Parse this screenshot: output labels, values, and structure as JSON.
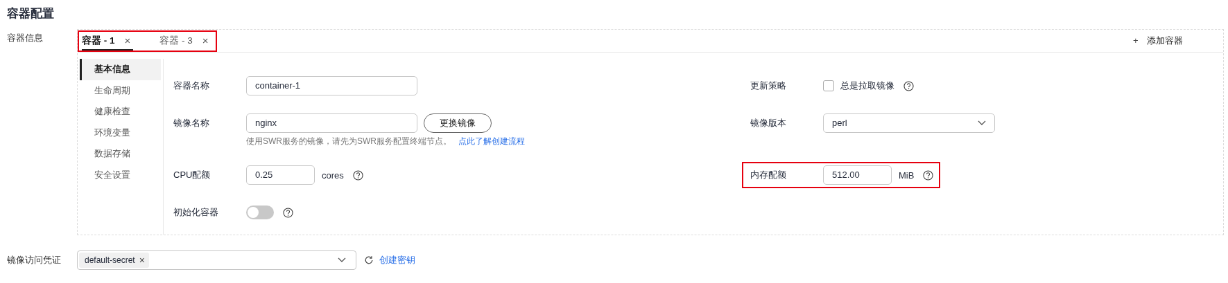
{
  "section_title": "容器配置",
  "container_info": {
    "label": "容器信息",
    "tabs_highlighted": true,
    "tabs": [
      {
        "label": "容器 - 1",
        "selected": true,
        "close": "×"
      },
      {
        "label": "容器 - 3",
        "selected": false,
        "close": "×"
      }
    ],
    "add_button": {
      "icon": "+",
      "label": "添加容器"
    },
    "sidebar": [
      {
        "label": "基本信息",
        "selected": true
      },
      {
        "label": "生命周期",
        "selected": false
      },
      {
        "label": "健康检查",
        "selected": false
      },
      {
        "label": "环境变量",
        "selected": false
      },
      {
        "label": "数据存储",
        "selected": false
      },
      {
        "label": "安全设置",
        "selected": false
      }
    ],
    "fields_left": [
      {
        "kind": "input",
        "label": "容器名称",
        "value": "container-1"
      },
      {
        "kind": "input_button",
        "label": "镜像名称",
        "value": "nginx",
        "button": "更换镜像",
        "hint": "使用SWR服务的镜像，请先为SWR服务配置终端节点。",
        "link": "点此了解创建流程"
      },
      {
        "kind": "unit",
        "label": "CPU配额",
        "value": "0.25",
        "unit": "cores",
        "help": true,
        "highlighted": false
      },
      {
        "kind": "switch",
        "label": "初始化容器",
        "on": false,
        "help": true
      }
    ],
    "fields_right": [
      {
        "kind": "checkbox",
        "label": "更新策略",
        "option": "总是拉取镜像",
        "checked": false,
        "help": true
      },
      {
        "kind": "select",
        "label": "镜像版本",
        "value": "perl"
      },
      {
        "kind": "unit",
        "label": "内存配额",
        "value": "512.00",
        "unit": "MiB",
        "help": true,
        "highlighted": true
      }
    ]
  },
  "credential": {
    "label": "镜像访问凭证",
    "tags": [
      {
        "label": "default-secret",
        "remove": "×"
      }
    ],
    "link": "创建密钥"
  }
}
